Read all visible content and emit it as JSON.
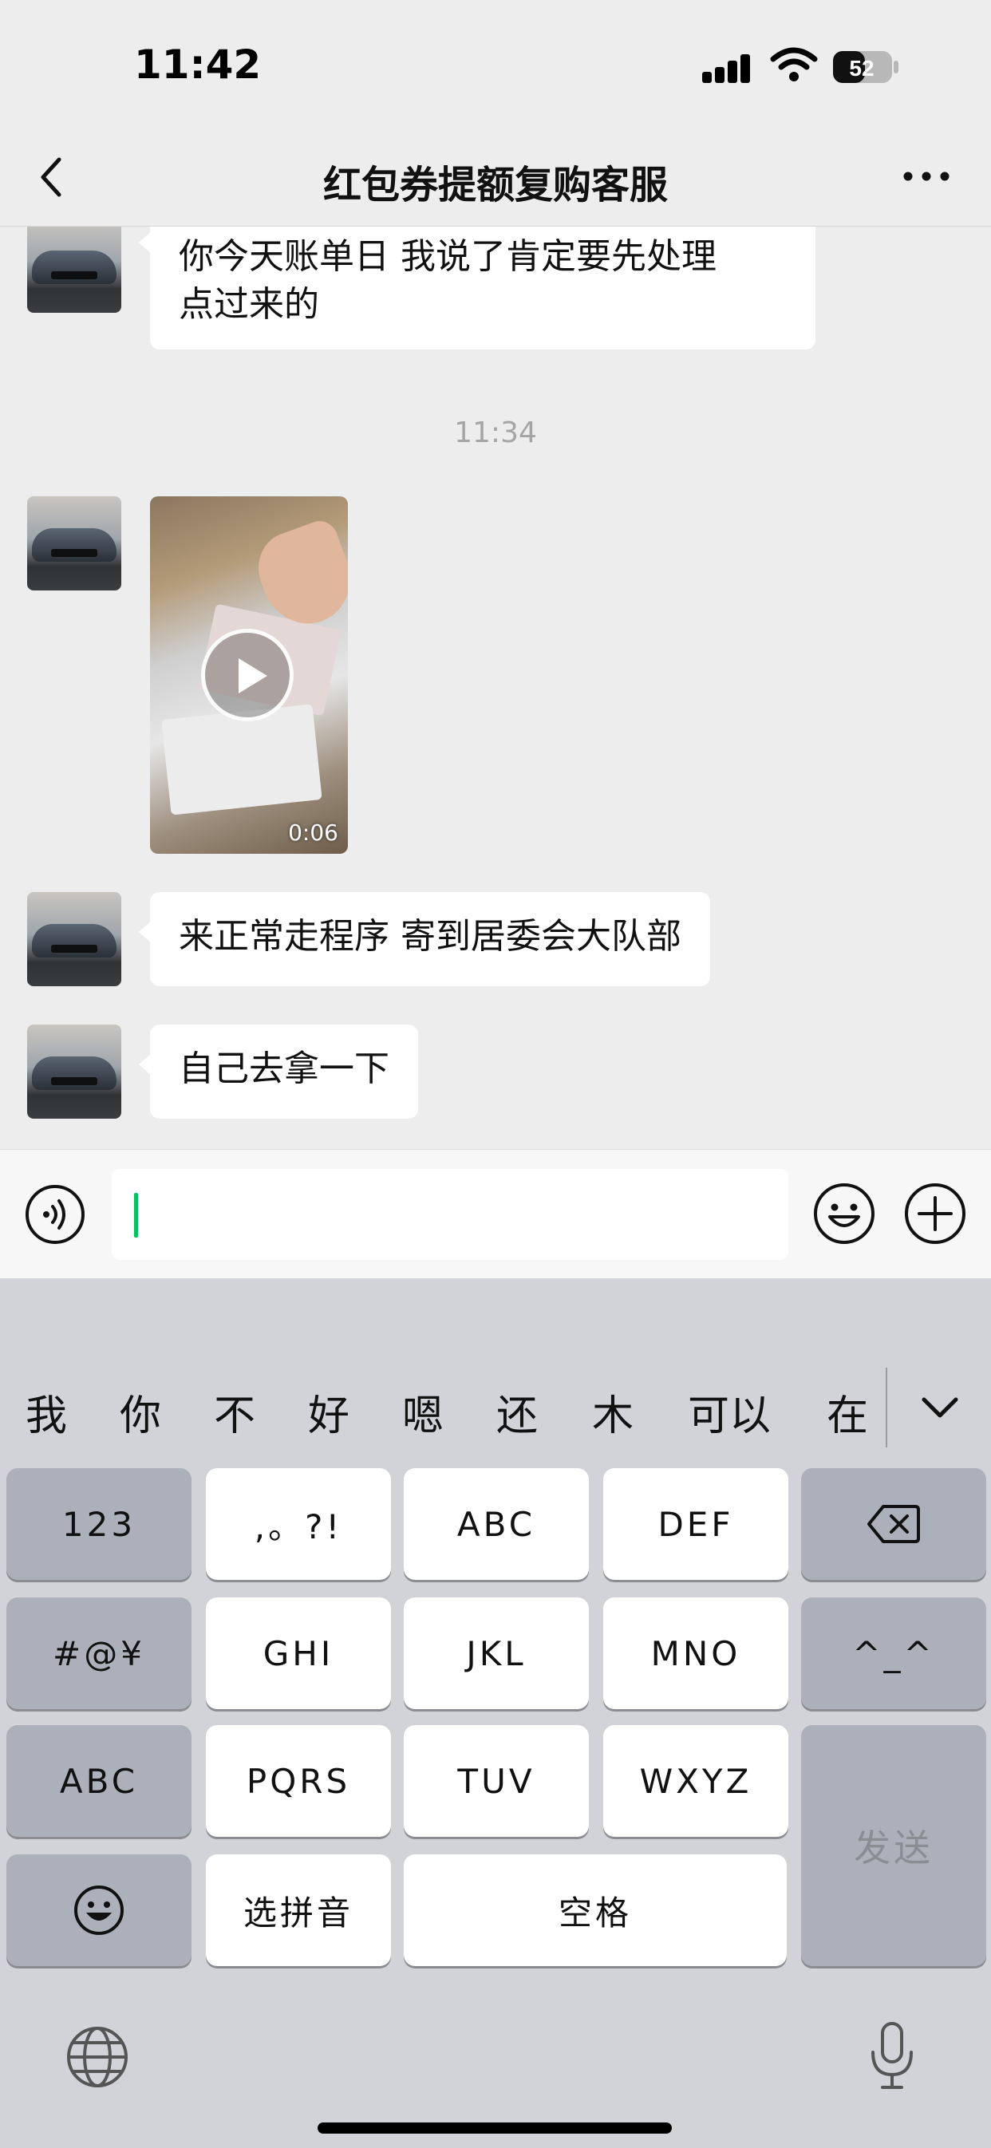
{
  "status_bar": {
    "time": "11:42",
    "battery": "52"
  },
  "nav": {
    "title": "红包券提额复购客服"
  },
  "chat": {
    "messages": [
      {
        "type": "text",
        "lines": [
          "你今天账单日 我说了肯定要先处理",
          "点过来的"
        ]
      },
      {
        "type": "timestamp",
        "text": "11:34"
      },
      {
        "type": "video",
        "duration": "0:06"
      },
      {
        "type": "text",
        "text": "来正常走程序 寄到居委会大队部"
      },
      {
        "type": "text",
        "text": "自己去拿一下"
      }
    ]
  },
  "input": {
    "value": ""
  },
  "keyboard": {
    "candidates": [
      "我",
      "你",
      "不",
      "好",
      "嗯",
      "还",
      "木",
      "可以",
      "在"
    ],
    "keys": {
      "num": "123",
      "punct": ",。?!",
      "abc_t9": "ABC",
      "def": "DEF",
      "symbols": "#@¥",
      "ghi": "GHI",
      "jkl": "JKL",
      "mno": "MNO",
      "kaomoji": "^_^",
      "abc_switch": "ABC",
      "pqrs": "PQRS",
      "tuv": "TUV",
      "wxyz": "WXYZ",
      "send": "发送",
      "pinyin": "选拼音",
      "space": "空格"
    }
  },
  "icons": [
    "back-icon",
    "more-icon",
    "play-icon",
    "voice-icon",
    "emoji-icon",
    "plus-icon",
    "backspace-icon",
    "smiley-key-icon",
    "chevron-down-icon",
    "globe-icon",
    "mic-icon",
    "signal-icon",
    "wifi-icon",
    "battery-icon"
  ],
  "colors": {
    "background": "#ededed",
    "bubble": "#ffffff",
    "cursor": "#07c160",
    "keyboard": "#d1d3d9",
    "dark_key": "#abb0ba"
  }
}
